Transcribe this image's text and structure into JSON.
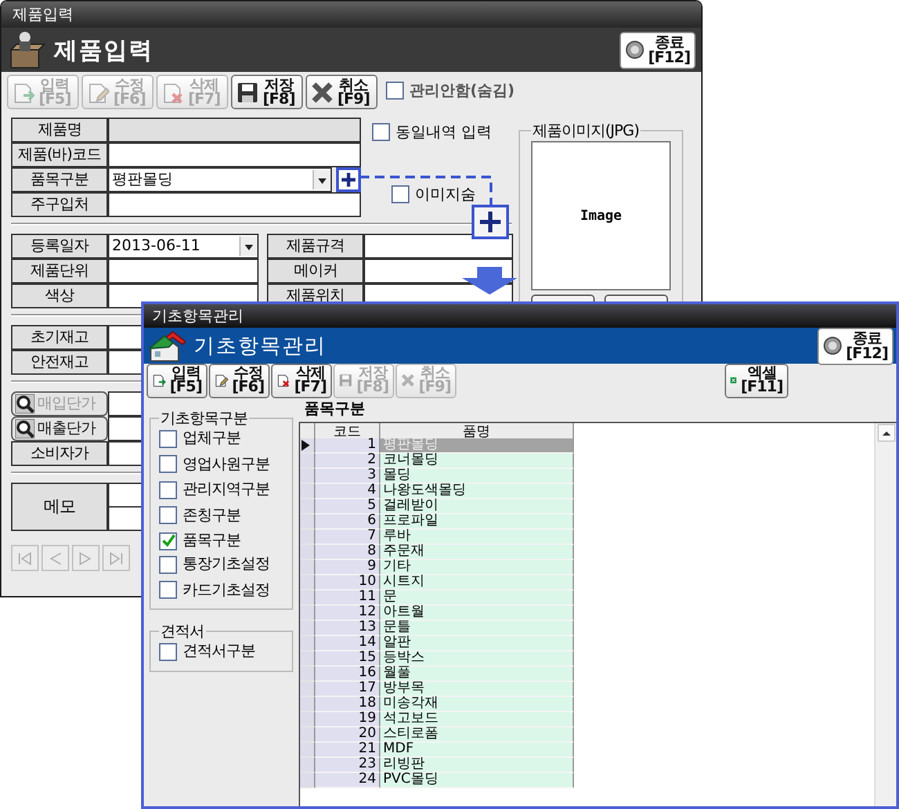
{
  "product_window": {
    "title": "제품입력",
    "header": "제품입력",
    "close_button": {
      "label": "종료",
      "key": "[F12]"
    },
    "toolbar": [
      {
        "kind": "new",
        "label": "입력",
        "key": "[F5]",
        "disabled": true
      },
      {
        "kind": "edit",
        "label": "수정",
        "key": "[F6]",
        "disabled": true
      },
      {
        "kind": "delete",
        "label": "삭제",
        "key": "[F7]",
        "disabled": true
      },
      {
        "kind": "save",
        "label": "저장",
        "key": "[F8]",
        "disabled": false
      },
      {
        "kind": "cancel",
        "label": "취소",
        "key": "[F9]",
        "disabled": false
      }
    ],
    "hide_checkbox": {
      "label": "관리안함(숨김)",
      "checked": false
    },
    "top_fields": [
      {
        "label": "제품명",
        "kind": "readonly"
      },
      {
        "label": "제품(바)코드",
        "kind": "text"
      },
      {
        "label": "품목구분",
        "kind": "dropdown",
        "value": "평판몰딩"
      },
      {
        "label": "주구입처",
        "kind": "text"
      }
    ],
    "same_entry_checkbox": {
      "label": "동일내역 입력",
      "checked": false
    },
    "hide_image_checkbox": {
      "label": "이미지숨",
      "checked": false
    },
    "image_panel": {
      "title": "제품이미지(JPG)",
      "image_text": "Image"
    },
    "detail_left": [
      {
        "label": "등록일자",
        "kind": "date",
        "value": "2013-06-11"
      },
      {
        "label": "제품단위",
        "kind": "text"
      },
      {
        "label": "색상",
        "kind": "text"
      }
    ],
    "detail_right": [
      {
        "label": "제품규격",
        "kind": "text"
      },
      {
        "label": "메이커",
        "kind": "text"
      },
      {
        "label": "제품위치",
        "kind": "text"
      }
    ],
    "stock_fields": [
      {
        "label": "초기재고"
      },
      {
        "label": "안전재고"
      }
    ],
    "price_fields": [
      {
        "label": "매입단가",
        "kind": "lookup",
        "disabled": true
      },
      {
        "label": "매출단가",
        "kind": "lookup",
        "disabled": false
      },
      {
        "label": "소비자가",
        "kind": "plain"
      }
    ],
    "memo": {
      "label": "메모"
    },
    "record_nav": {
      "disabled": true
    }
  },
  "category_window": {
    "title": "기초항목관리",
    "header": "기초항목관리",
    "close_button": {
      "label": "종료",
      "key": "[F12]"
    },
    "toolbar": [
      {
        "kind": "new",
        "label": "입력",
        "key": "[F5]",
        "disabled": false
      },
      {
        "kind": "edit",
        "label": "수정",
        "key": "[F6]",
        "disabled": false
      },
      {
        "kind": "delete",
        "label": "삭제",
        "key": "[F7]",
        "disabled": false
      },
      {
        "kind": "save",
        "label": "저장",
        "key": "[F8]",
        "disabled": true
      },
      {
        "kind": "cancel",
        "label": "취소",
        "key": "[F9]",
        "disabled": true
      }
    ],
    "excel_button": {
      "kind": "excel",
      "label": "엑셀",
      "key": "[F11]",
      "disabled": false
    },
    "groups": [
      {
        "title": "기초항목구분",
        "items": [
          {
            "label": "업체구분",
            "checked": false
          },
          {
            "label": "영업사원구분",
            "checked": false
          },
          {
            "label": "관리지역구분",
            "checked": false
          },
          {
            "label": "존칭구분",
            "checked": false
          },
          {
            "label": "품목구분",
            "checked": true
          },
          {
            "label": "통장기초설정",
            "checked": false
          },
          {
            "label": "카드기초설정",
            "checked": false
          }
        ]
      },
      {
        "title": "견적서",
        "items": [
          {
            "label": "견적서구분",
            "checked": false
          }
        ]
      }
    ],
    "table": {
      "caption": "품목구분",
      "columns": [
        "코드",
        "품명"
      ],
      "rows": [
        {
          "code": "1",
          "name": "평판몰딩",
          "selected": true
        },
        {
          "code": "2",
          "name": "코너몰딩",
          "selected": false
        },
        {
          "code": "3",
          "name": "몰딩",
          "selected": false
        },
        {
          "code": "4",
          "name": "나왕도색몰딩",
          "selected": false
        },
        {
          "code": "5",
          "name": "걸레받이",
          "selected": false
        },
        {
          "code": "6",
          "name": "프로파일",
          "selected": false
        },
        {
          "code": "7",
          "name": "루바",
          "selected": false
        },
        {
          "code": "8",
          "name": "주문재",
          "selected": false
        },
        {
          "code": "9",
          "name": "기타",
          "selected": false
        },
        {
          "code": "10",
          "name": "시트지",
          "selected": false
        },
        {
          "code": "11",
          "name": "문",
          "selected": false
        },
        {
          "code": "12",
          "name": "아트월",
          "selected": false
        },
        {
          "code": "13",
          "name": "문틀",
          "selected": false
        },
        {
          "code": "14",
          "name": "알판",
          "selected": false
        },
        {
          "code": "15",
          "name": "등박스",
          "selected": false
        },
        {
          "code": "16",
          "name": "월풀",
          "selected": false
        },
        {
          "code": "17",
          "name": "방부목",
          "selected": false
        },
        {
          "code": "18",
          "name": "미송각재",
          "selected": false
        },
        {
          "code": "19",
          "name": "석고보드",
          "selected": false
        },
        {
          "code": "20",
          "name": "스티로폼",
          "selected": false
        },
        {
          "code": "21",
          "name": "MDF",
          "selected": false
        },
        {
          "code": "23",
          "name": "리빙판",
          "selected": false
        },
        {
          "code": "24",
          "name": "PVC몰딩",
          "selected": false
        }
      ]
    }
  }
}
